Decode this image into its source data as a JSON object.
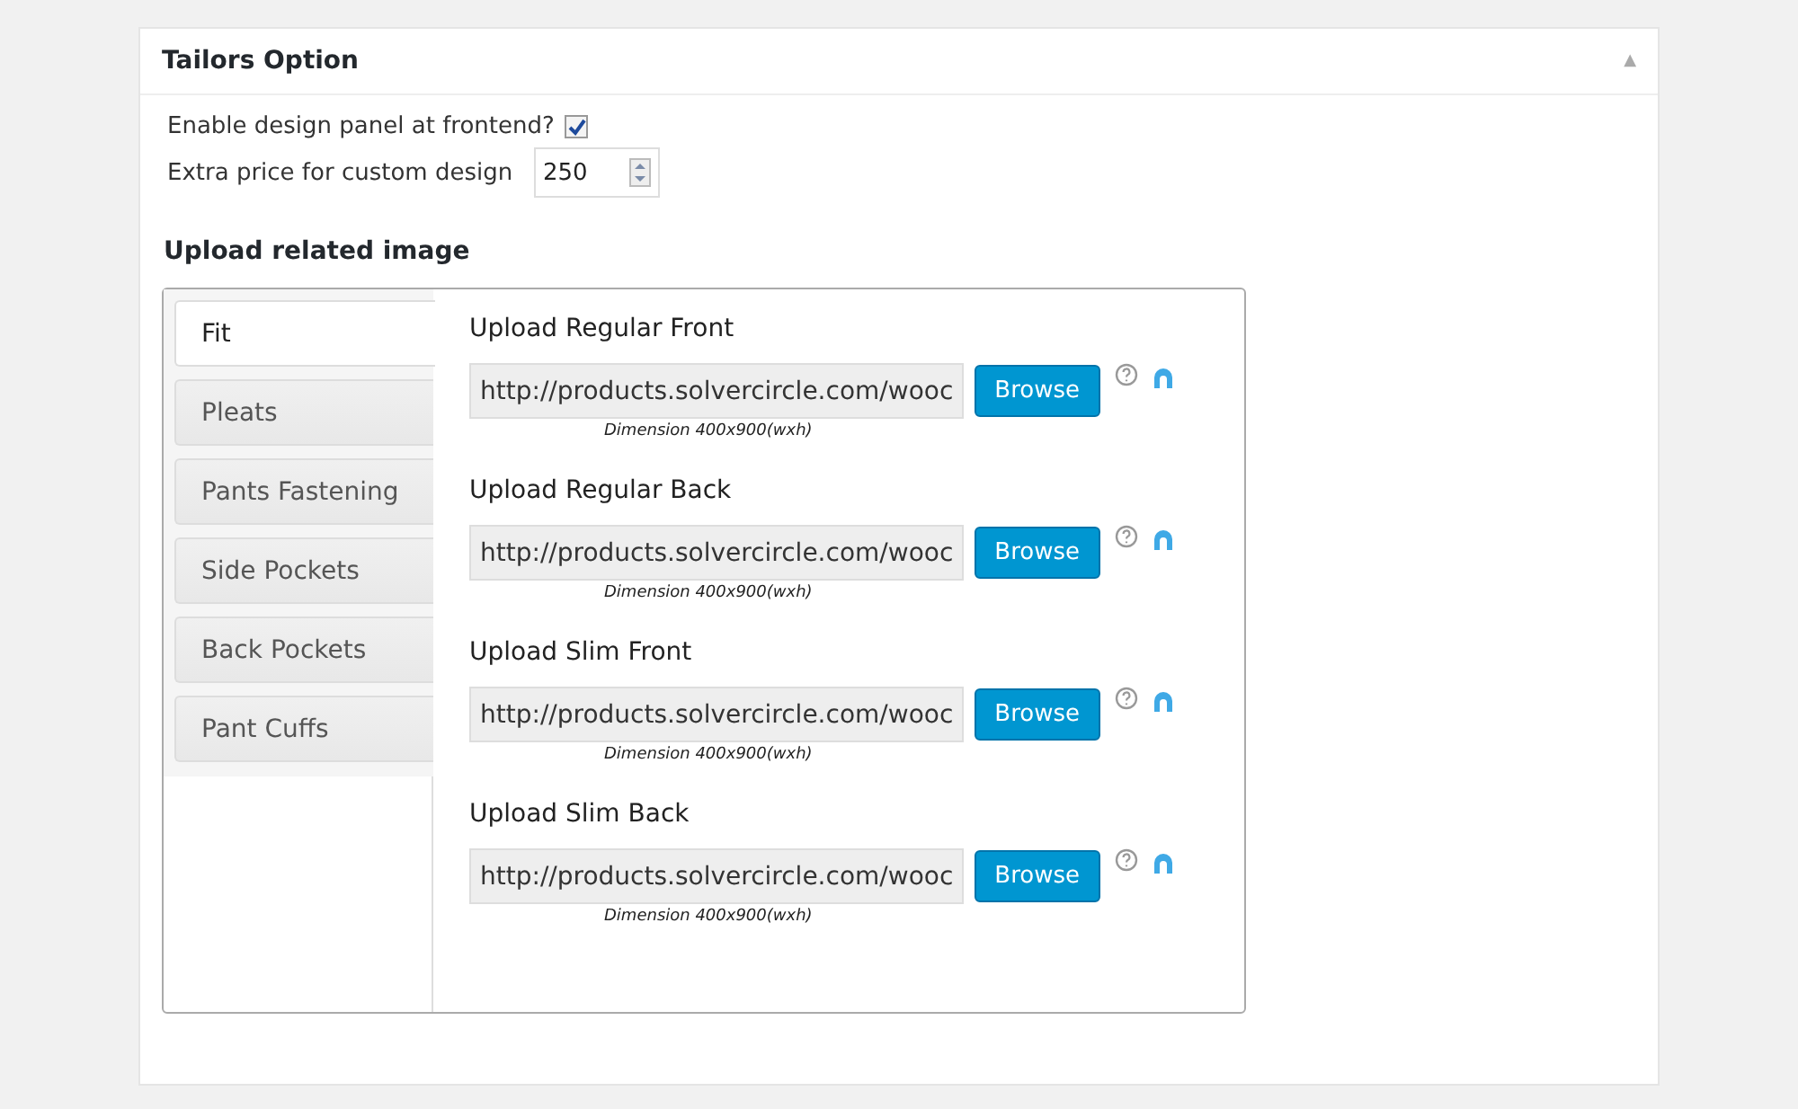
{
  "panel": {
    "title": "Tailors Option",
    "collapse_icon": "▲"
  },
  "settings": [
    {
      "kind": "checkbox",
      "label": "Enable design panel at frontend?",
      "checked": true
    },
    {
      "kind": "number",
      "label": "Extra price for custom design",
      "value": "250"
    }
  ],
  "section_title": "Upload related image",
  "tabs": [
    {
      "label": "Fit",
      "selected": true
    },
    {
      "label": "Pleats",
      "selected": false
    },
    {
      "label": "Pants Fastening",
      "selected": false
    },
    {
      "label": "Side Pockets",
      "selected": false
    },
    {
      "label": "Back Pockets",
      "selected": false
    },
    {
      "label": "Pant Cuffs",
      "selected": false
    }
  ],
  "uploads": [
    {
      "label": "Upload Regular Front",
      "value": "http://products.solvercircle.com/wooc",
      "button": "Browse",
      "hint": "Dimension 400x900(wxh)"
    },
    {
      "label": "Upload Regular Back",
      "value": "http://products.solvercircle.com/wooc",
      "button": "Browse",
      "hint": "Dimension 400x900(wxh)"
    },
    {
      "label": "Upload Slim Front",
      "value": "http://products.solvercircle.com/wooc",
      "button": "Browse",
      "hint": "Dimension 400x900(wxh)"
    },
    {
      "label": "Upload Slim Back",
      "value": "http://products.solvercircle.com/wooc",
      "button": "Browse",
      "hint": "Dimension 400x900(wxh)"
    }
  ]
}
